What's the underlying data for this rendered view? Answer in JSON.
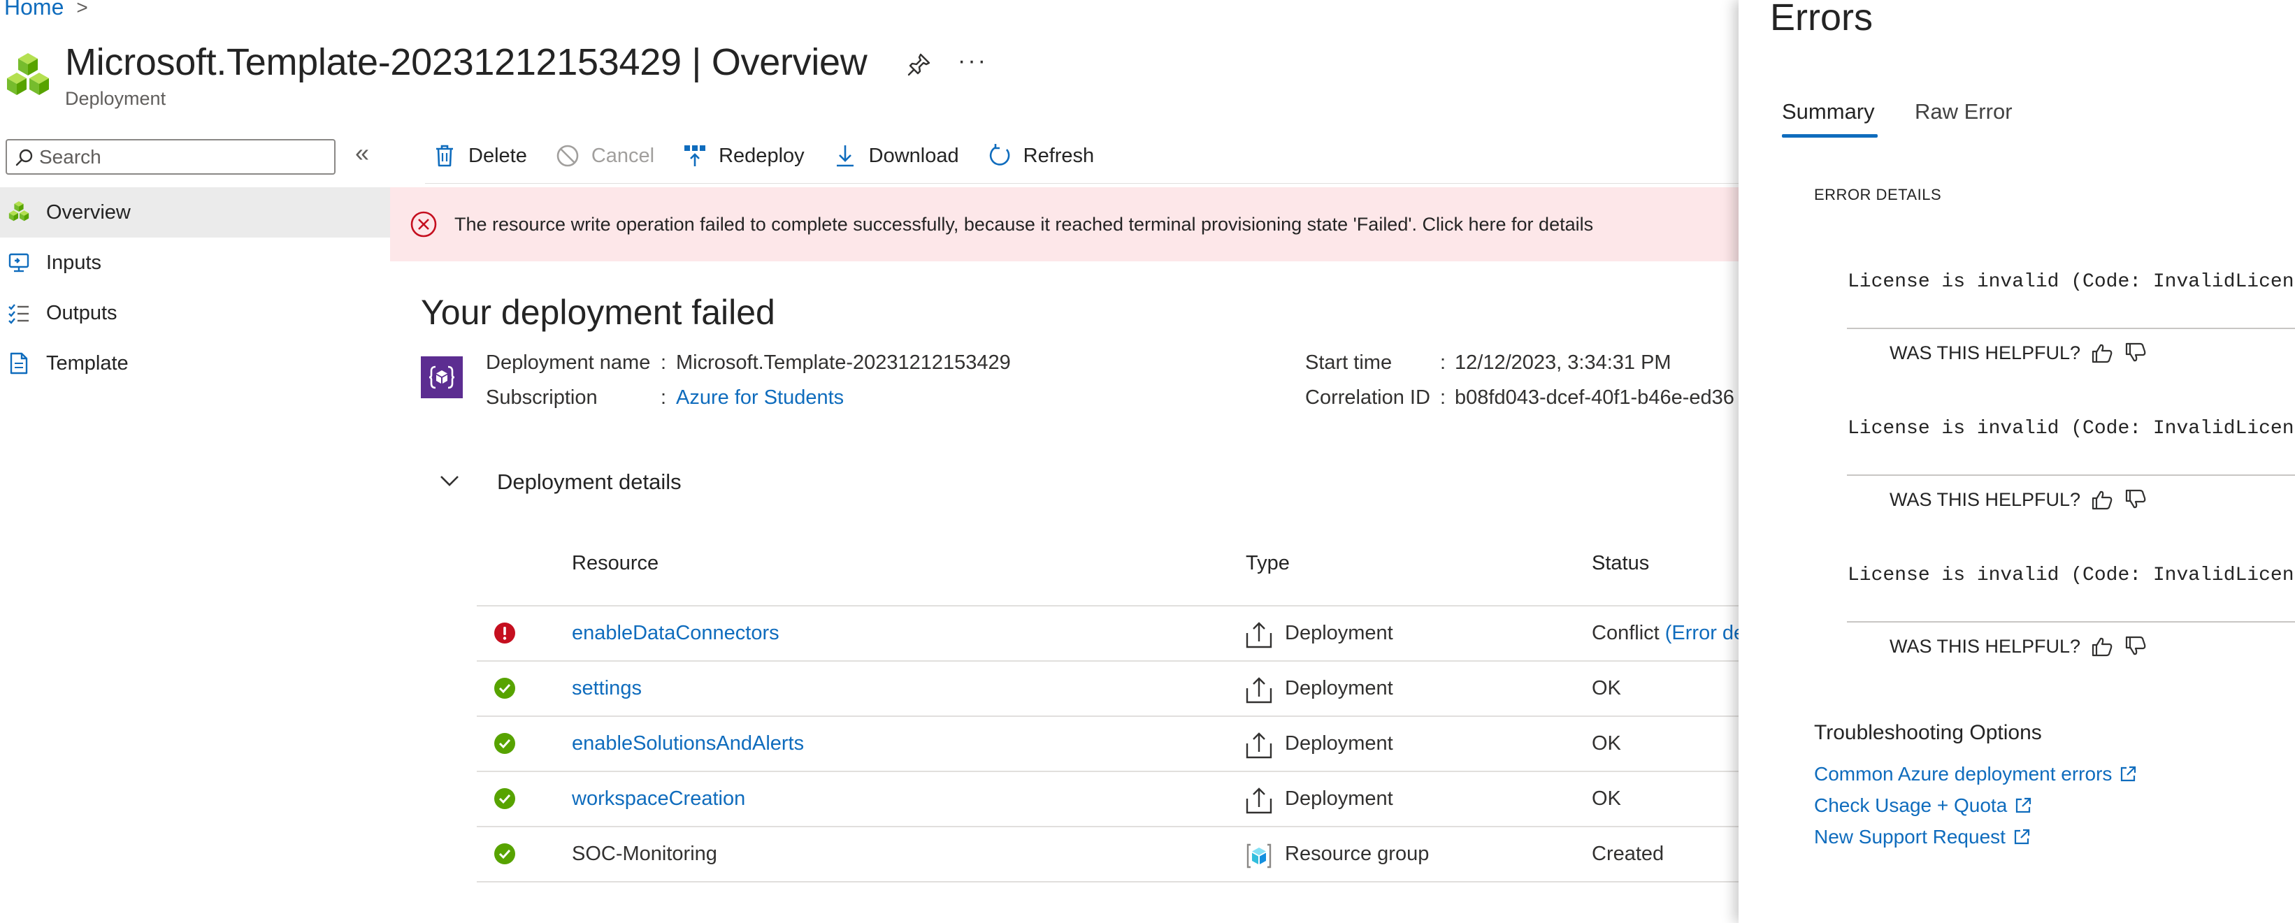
{
  "breadcrumb": {
    "home": "Home",
    "separator": ">"
  },
  "header": {
    "title": "Microsoft.Template-20231212153429 | Overview",
    "subtitle": "Deployment",
    "more": "···"
  },
  "sidebar": {
    "search_placeholder": "Search",
    "collapse": "«",
    "items": [
      {
        "label": "Overview",
        "icon": "deployment-cubes-icon",
        "active": true
      },
      {
        "label": "Inputs",
        "icon": "inputs-monitor-icon"
      },
      {
        "label": "Outputs",
        "icon": "outputs-checklist-icon"
      },
      {
        "label": "Template",
        "icon": "template-document-icon"
      }
    ]
  },
  "toolbar": {
    "delete": "Delete",
    "cancel": "Cancel",
    "redeploy": "Redeploy",
    "download": "Download",
    "refresh": "Refresh"
  },
  "banner": {
    "message": "The resource write operation failed to complete successfully, because it reached terminal provisioning state 'Failed'. Click here for details"
  },
  "deployment": {
    "heading": "Your deployment failed",
    "name_label": "Deployment name",
    "name_value": "Microsoft.Template-20231212153429",
    "subscription_label": "Subscription",
    "subscription_value": "Azure for Students",
    "start_time_label": "Start time",
    "start_time_value": "12/12/2023, 3:34:31 PM",
    "correlation_label": "Correlation ID",
    "correlation_value": "b08fd043-dcef-40f1-b46e-ed36",
    "separator": ":"
  },
  "details": {
    "title": "Deployment details",
    "columns": {
      "resource": "Resource",
      "type": "Type",
      "status": "Status"
    },
    "rows": [
      {
        "resource": "enableDataConnectors",
        "resource_is_link": true,
        "type": "Deployment",
        "status": "Conflict",
        "status_link": "(Error de",
        "state": "error"
      },
      {
        "resource": "settings",
        "resource_is_link": true,
        "type": "Deployment",
        "status": "OK",
        "state": "success"
      },
      {
        "resource": "enableSolutionsAndAlerts",
        "resource_is_link": true,
        "type": "Deployment",
        "status": "OK",
        "state": "success"
      },
      {
        "resource": "workspaceCreation",
        "resource_is_link": true,
        "type": "Deployment",
        "status": "OK",
        "state": "success"
      },
      {
        "resource": "SOC-Monitoring",
        "resource_is_link": false,
        "type": "Resource group",
        "status": "Created",
        "state": "success"
      }
    ]
  },
  "errors_panel": {
    "title": "Errors",
    "tabs": [
      "Summary",
      "Raw Error"
    ],
    "section_label": "ERROR DETAILS",
    "errors": [
      {
        "message": "License is invalid (Code: InvalidLicense",
        "helpful": "WAS THIS HELPFUL?"
      },
      {
        "message": "License is invalid (Code: InvalidLicense",
        "helpful": "WAS THIS HELPFUL?"
      },
      {
        "message": "License is invalid (Code: InvalidLicense",
        "helpful": "WAS THIS HELPFUL?"
      }
    ],
    "troubleshooting_title": "Troubleshooting Options",
    "links": [
      "Common Azure deployment errors",
      "Check Usage + Quota",
      "New Support Request"
    ]
  },
  "colors": {
    "accent": "#0f6cbd",
    "error": "#c50f1f",
    "success": "#57a300",
    "banner_bg": "#fde7e9",
    "deployment_icon_bg": "#5c2d91"
  }
}
